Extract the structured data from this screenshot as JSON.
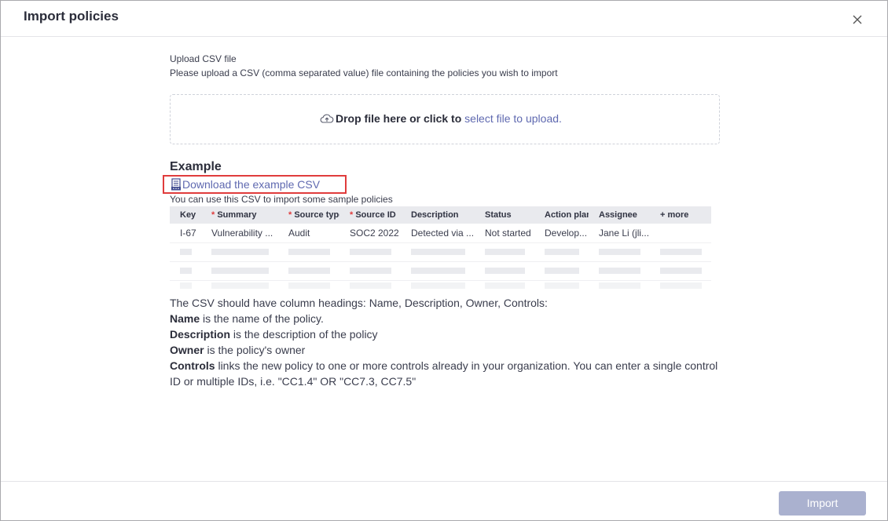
{
  "dialog": {
    "title": "Import policies",
    "close_icon": "close-icon"
  },
  "upload": {
    "label": "Upload CSV file",
    "description": "Please upload a CSV (comma separated value) file containing the policies you wish to import",
    "dropzone": {
      "icon": "cloud-upload-icon",
      "strong_text": "Drop file here or click to",
      "link_text": "select file to upload."
    }
  },
  "example": {
    "heading": "Example",
    "download_icon": "csv-file-icon",
    "download_link": "Download the example CSV",
    "subtext": "You can use this CSV to import some sample policies",
    "table": {
      "columns": [
        {
          "label": "Key",
          "required": false
        },
        {
          "label": "Summary",
          "required": true
        },
        {
          "label": "Source type",
          "required": true
        },
        {
          "label": "Source ID",
          "required": true
        },
        {
          "label": "Description",
          "required": false
        },
        {
          "label": "Status",
          "required": false
        },
        {
          "label": "Action plan",
          "required": false
        },
        {
          "label": "Assignee",
          "required": false
        },
        {
          "label": "+ more",
          "required": false
        }
      ],
      "row": [
        "I-67",
        "Vulnerability ...",
        "Audit",
        "SOC2 2022",
        "Detected via ...",
        "Not started",
        "Develop...",
        "Jane Li (jli...",
        ""
      ]
    }
  },
  "notes": {
    "intro": "The CSV should have column headings: Name, Description, Owner, Controls:",
    "name_term": "Name",
    "name_desc": " is the name of the policy.",
    "description_term": "Description",
    "description_desc": " is the description of the policy",
    "owner_term": "Owner",
    "owner_desc": " is the policy's owner",
    "controls_term": "Controls",
    "controls_desc": " links the new policy to one or more controls already in your organization. You can enter a single control ID or multiple IDs, i.e. \"CC1.4\" OR \"CC7.3, CC7.5\""
  },
  "footer": {
    "import_label": "Import"
  },
  "colors": {
    "link": "#5f69b0",
    "highlight_border": "#e03c3c",
    "disabled_button": "#aab1cf"
  }
}
